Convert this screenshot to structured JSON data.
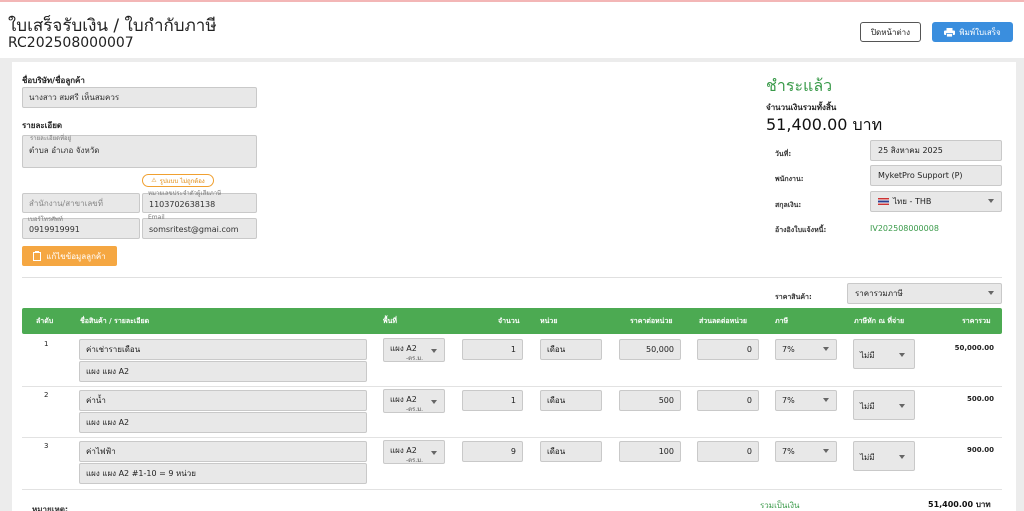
{
  "header": {
    "title": "ใบเสร็จรับเงิน / ใบกำกับภาษี",
    "doc_no": "RC202508000007",
    "close_label": "ปิดหน้าต่าง",
    "print_label": "พิมพ์ใบเสร็จ"
  },
  "customer": {
    "company_label": "ชื่อบริษัท/ชื่อลูกค้า",
    "company_value": "นางสาว สมศรี เห็นสมควร",
    "detail_label": "รายละเอียด",
    "address_mini": "รายละเอียดที่อยู่",
    "address_value": "ตำบล อำเภอ จังหวัด",
    "warn_label": "รูปแบบ ไม่ถูกต้อง",
    "branch_placeholder": "สำนักงาน/สาขาเลขที่",
    "taxid_mini": "หมายเลขประจำตัวผู้เสียภาษี",
    "taxid_value": "1103702638138",
    "phone_mini": "เบอร์โทรศัพท์",
    "phone_value": "0919919991",
    "email_mini": "Email",
    "email_value": "somsritest@gmai.com",
    "edit_label": "แก้ไขข้อมูลลูกค้า"
  },
  "summary": {
    "status": "ชำระแล้ว",
    "total_label": "จำนวนเงินรวมทั้งสิ้น",
    "total_value": "51,400.00 บาท",
    "date_label": "วันที่:",
    "date_value": "25 สิงหาคม 2025",
    "staff_label": "พนักงาน:",
    "staff_value": "MyketPro Support (P)",
    "currency_label": "สกุลเงิน:",
    "currency_value": "ไทย - THB",
    "ref_label": "อ้างอิงใบแจ้งหนี้:",
    "ref_value": "IV202508000008",
    "price_label": "ราคาสินค้า:",
    "price_value": "ราคารวมภาษี"
  },
  "table": {
    "headers": {
      "no": "ลำดับ",
      "name": "ชื่อสินค้า / รายละเอียด",
      "area": "พื้นที่",
      "qty": "จำนวน",
      "unit": "หน่วย",
      "price": "ราคาต่อหน่วย",
      "discount": "ส่วนลดต่อหน่วย",
      "tax": "ภาษี",
      "wht": "ภาษีหัก ณ ที่จ่าย",
      "total": "ราคารวม"
    },
    "rows": [
      {
        "no": "1",
        "name": "ค่าเช่ารายเดือน",
        "detail": "แผง แผง A2",
        "area": "แผง A2",
        "area_sub": "-ตร.ม.",
        "qty": "1",
        "unit": "เดือน",
        "price": "50,000",
        "discount": "0",
        "tax": "7%",
        "wht": "ไม่มี",
        "total": "50,000.00"
      },
      {
        "no": "2",
        "name": "ค่าน้ำ",
        "detail": "แผง แผง A2",
        "area": "แผง A2",
        "area_sub": "-ตร.ม.",
        "qty": "1",
        "unit": "เดือน",
        "price": "500",
        "discount": "0",
        "tax": "7%",
        "wht": "ไม่มี",
        "total": "500.00"
      },
      {
        "no": "3",
        "name": "ค่าไฟฟ้า",
        "detail": "แผง แผง A2 #1-10 = 9 หน่วย",
        "area": "แผง A2",
        "area_sub": "-ตร.ม.",
        "qty": "9",
        "unit": "เดือน",
        "price": "100",
        "discount": "0",
        "tax": "7%",
        "wht": "ไม่มี",
        "total": "900.00"
      }
    ]
  },
  "footer": {
    "sum_label": "รวมเป็นเงิน",
    "sum_value": "51,400.00 บาท",
    "left_label": "หมายเหตุ:"
  },
  "colors": {
    "accent_green": "#4caa52",
    "accent_blue": "#3a8ede",
    "accent_orange": "#f5a742"
  }
}
